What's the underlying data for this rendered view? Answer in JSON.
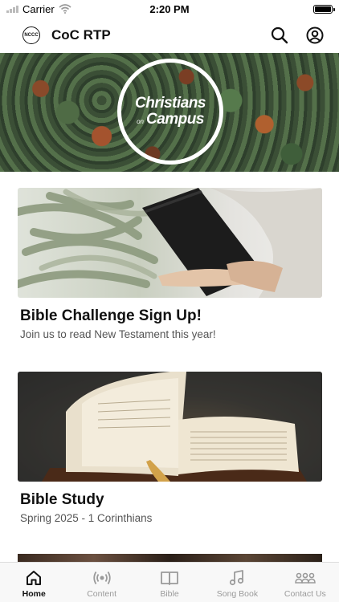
{
  "status_bar": {
    "carrier": "Carrier",
    "time": "2:20 PM"
  },
  "header": {
    "logo_text": "NCCC",
    "title": "CoC RTP",
    "search_icon": "search-icon",
    "profile_icon": "user-circle-icon"
  },
  "hero": {
    "line1": "Christians",
    "line2": "on",
    "line3": "Campus"
  },
  "cards": [
    {
      "title": "Bible Challenge Sign Up!",
      "subtitle": "Join us to read New Testament this year!"
    },
    {
      "title": "Bible Study",
      "subtitle": "Spring 2025 - 1 Corinthians"
    }
  ],
  "tabs": [
    {
      "label": "Home",
      "icon": "home-icon",
      "active": true
    },
    {
      "label": "Content",
      "icon": "broadcast-icon",
      "active": false
    },
    {
      "label": "Bible",
      "icon": "book-icon",
      "active": false
    },
    {
      "label": "Song Book",
      "icon": "music-note-icon",
      "active": false
    },
    {
      "label": "Contact Us",
      "icon": "group-icon",
      "active": false
    }
  ],
  "colors": {
    "active_tab": "#111111",
    "inactive_tab": "#9a9a9a",
    "hero_text": "#ffffff"
  }
}
